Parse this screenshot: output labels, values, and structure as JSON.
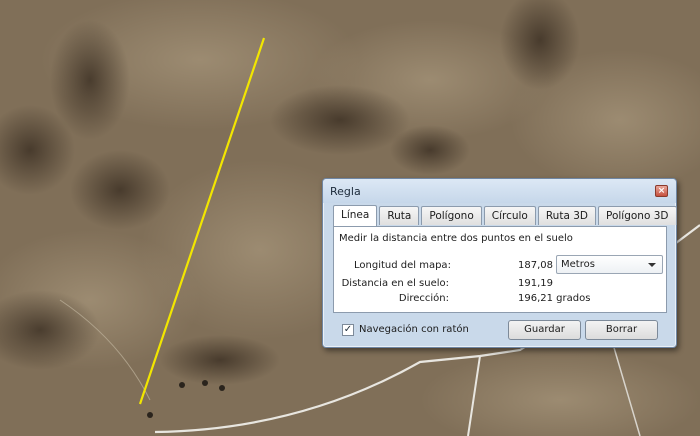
{
  "dialog": {
    "title": "Regla",
    "close_glyph": "×",
    "tabs": [
      {
        "label": "Línea",
        "active": true
      },
      {
        "label": "Ruta",
        "active": false
      },
      {
        "label": "Polígono",
        "active": false
      },
      {
        "label": "Círculo",
        "active": false
      },
      {
        "label": "Ruta 3D",
        "active": false
      },
      {
        "label": "Polígono 3D",
        "active": false
      }
    ],
    "description": "Medir la distancia entre dos puntos en el suelo",
    "map_length_label": "Longitud del mapa:",
    "map_length_value": "187,08",
    "unit_selected": "Metros",
    "ground_distance_label": "Distancia en el suelo:",
    "ground_distance_value": "191,19",
    "direction_label": "Dirección:",
    "direction_value": "196,21 grados",
    "mouse_nav_label": "Navegación con ratón",
    "mouse_nav_checked": true,
    "check_glyph": "✓",
    "save_label": "Guardar",
    "delete_label": "Borrar"
  },
  "map": {
    "terrain_color": "#7a6a55",
    "measure_line_color": "#f2e600",
    "road_color": "#e8e6e0"
  }
}
